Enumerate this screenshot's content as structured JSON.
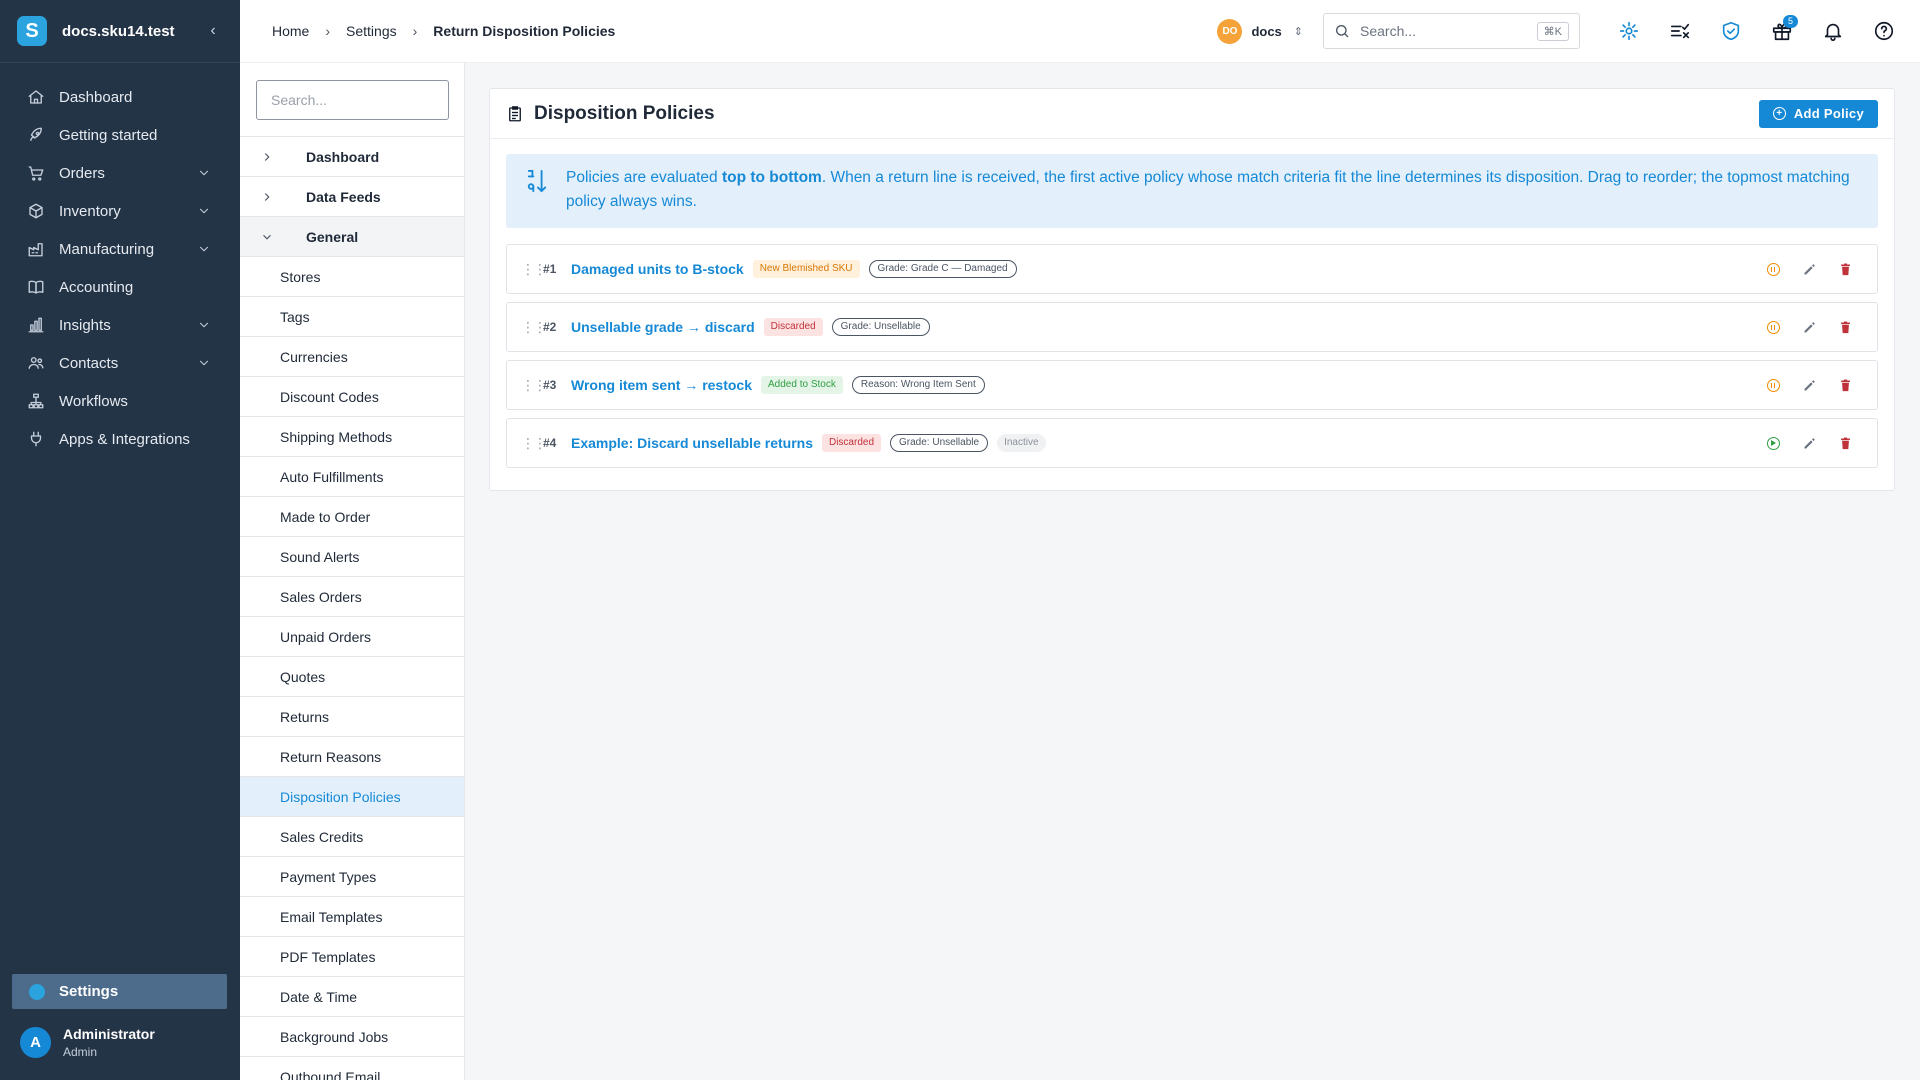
{
  "app": {
    "brand_letter": "S",
    "workspace_host": "docs.sku14.test",
    "collapse_glyph": "‹"
  },
  "nav": {
    "items": [
      {
        "label": "Dashboard",
        "icon": "home-icon",
        "expandable": false
      },
      {
        "label": "Getting started",
        "icon": "rocket-icon",
        "expandable": false
      },
      {
        "label": "Orders",
        "icon": "cart-icon",
        "expandable": true
      },
      {
        "label": "Inventory",
        "icon": "box-icon",
        "expandable": true
      },
      {
        "label": "Manufacturing",
        "icon": "factory-icon",
        "expandable": true
      },
      {
        "label": "Accounting",
        "icon": "book-icon",
        "expandable": false
      },
      {
        "label": "Insights",
        "icon": "chart-icon",
        "expandable": true
      },
      {
        "label": "Contacts",
        "icon": "users-icon",
        "expandable": true
      },
      {
        "label": "Workflows",
        "icon": "sitemap-icon",
        "expandable": false
      },
      {
        "label": "Apps & Integrations",
        "icon": "plug-icon",
        "expandable": false
      }
    ],
    "settings_label": "Settings"
  },
  "user": {
    "initial": "A",
    "name": "Administrator",
    "role": "Admin"
  },
  "topbar": {
    "breadcrumb": [
      "Home",
      "Settings",
      "Return Disposition Policies"
    ],
    "separator": "›",
    "workspace_badge": "DO",
    "workspace_name": "docs",
    "search_placeholder": "Search...",
    "search_shortcut": "⌘K",
    "notification_count": "5"
  },
  "subnav": {
    "search_placeholder": "Search...",
    "groups": [
      {
        "label": "Dashboard",
        "open": false
      },
      {
        "label": "Data Feeds",
        "open": false
      },
      {
        "label": "General",
        "open": true
      }
    ],
    "items": [
      "Stores",
      "Tags",
      "Currencies",
      "Discount Codes",
      "Shipping Methods",
      "Auto Fulfillments",
      "Made to Order",
      "Sound Alerts",
      "Sales Orders",
      "Unpaid Orders",
      "Quotes",
      "Returns",
      "Return Reasons",
      "Disposition Policies",
      "Sales Credits",
      "Payment Types",
      "Email Templates",
      "PDF Templates",
      "Date & Time",
      "Background Jobs",
      "Outbound Email"
    ],
    "active": "Disposition Policies"
  },
  "panel": {
    "title": "Disposition Policies",
    "add_button": "Add Policy",
    "info": {
      "before": "Policies are evaluated ",
      "emphasis": "top to bottom",
      "after": ". When a return line is received, the first active policy whose match criteria fit the line determines its disposition. Drag to reorder; the topmost matching policy always wins."
    },
    "policies": [
      {
        "index": "#1",
        "name": "Damaged units to B-stock",
        "action": "New Blemished SKU",
        "action_color": "orange",
        "criteria": "Grade: Grade C — Damaged",
        "inactive": "",
        "active": true
      },
      {
        "index": "#2",
        "name": "Unsellable grade → discard",
        "action": "Discarded",
        "action_color": "red",
        "criteria": "Grade: Unsellable",
        "inactive": "",
        "active": true
      },
      {
        "index": "#3",
        "name": "Wrong item sent → restock",
        "action": "Added to Stock",
        "action_color": "green",
        "criteria": "Reason: Wrong Item Sent",
        "inactive": "",
        "active": true
      },
      {
        "index": "#4",
        "name": "Example: Discard unsellable returns",
        "action": "Discarded",
        "action_color": "red",
        "criteria": "Grade: Unsellable",
        "inactive": "Inactive",
        "active": false
      }
    ]
  },
  "colors": {
    "sidebar_bg": "#243447",
    "accent": "#1689d6",
    "info_bg": "#e3f0fb",
    "delete": "#c0323a",
    "pause": "#f08c00",
    "play": "#2f9e44"
  }
}
